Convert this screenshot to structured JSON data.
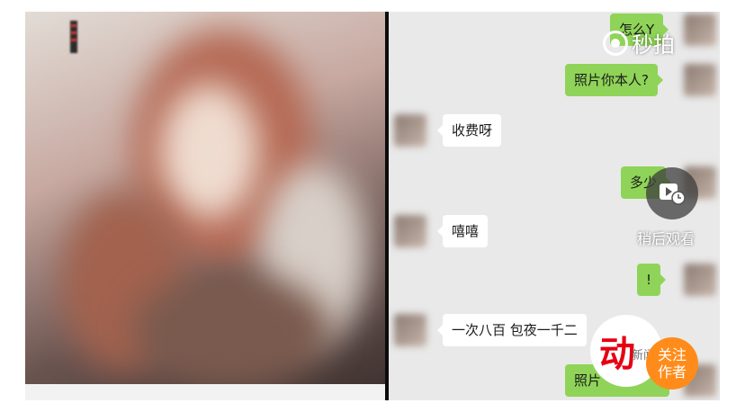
{
  "watermark": {
    "text": "秒拍"
  },
  "chat": {
    "messages": [
      {
        "side": "out",
        "text": "怎么Y"
      },
      {
        "side": "out",
        "text": "照片你本人?"
      },
      {
        "side": "in",
        "text": "收费呀"
      },
      {
        "side": "out",
        "text": "多少"
      },
      {
        "side": "in",
        "text": "嘻嘻"
      },
      {
        "side": "out",
        "text": "!"
      },
      {
        "side": "in",
        "text": "一次八百 包夜一千二"
      },
      {
        "side": "out",
        "text": "照片"
      }
    ]
  },
  "overlay": {
    "watch_later_label": "稍后观看",
    "logo_char": "动",
    "logo_small": "新闻",
    "follow_label": "关注作者"
  },
  "colors": {
    "outgoing_bubble": "#8fd458",
    "incoming_bubble": "#ffffff",
    "follow_accent": "#ff8c1a",
    "logo_red": "#e60012"
  }
}
